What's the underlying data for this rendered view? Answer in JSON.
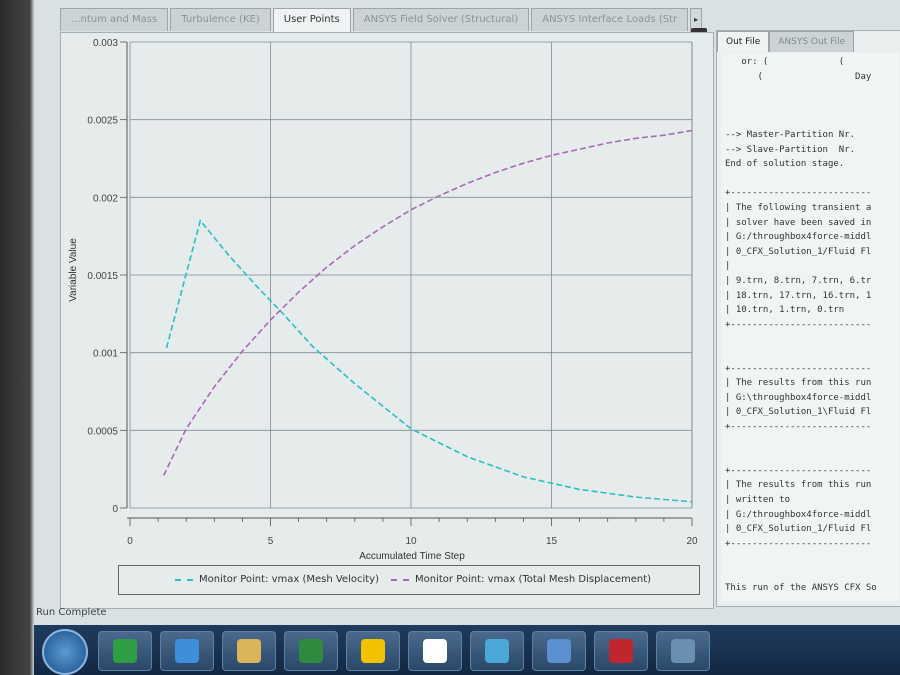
{
  "tabs": [
    "...ntum and Mass",
    "Turbulence (KE)",
    "User Points",
    "ANSYS Field Solver (Structural)",
    "ANSYS Interface Loads (Str"
  ],
  "active_tab": "User Points",
  "tab_scroll_glyph": "▸",
  "close_glyph": "✕",
  "chart_data": {
    "type": "line",
    "xlabel": "Accumulated Time Step",
    "ylabel": "Variable Value",
    "xlim": [
      0,
      20
    ],
    "ylim": [
      0,
      0.003
    ],
    "x_ticks": [
      "0",
      "5",
      "10",
      "15",
      "20"
    ],
    "y_ticks": [
      "0",
      "0.0005",
      "0.001",
      "0.0015",
      "0.002",
      "0.0025",
      "0.003"
    ],
    "grid": true,
    "legend_position": "bottom",
    "series": [
      {
        "name": "Monitor Point: vmax (Mesh Velocity)",
        "color": "#2bbfc4",
        "x": [
          1.3,
          2.5,
          3.5,
          4.5,
          5.5,
          6.5,
          8,
          10,
          12,
          14,
          16,
          18,
          20
        ],
        "y": [
          0.00103,
          0.00185,
          0.00163,
          0.00143,
          0.00124,
          0.00104,
          0.0008,
          0.00051,
          0.00033,
          0.0002,
          0.00012,
          7e-05,
          4e-05
        ]
      },
      {
        "name": "Monitor Point: vmax (Total Mesh Displacement)",
        "color": "#a968b8",
        "x": [
          1.2,
          2,
          3,
          4,
          5,
          6,
          7,
          8,
          9,
          10,
          11,
          12,
          13,
          14,
          15,
          16,
          17,
          18,
          19,
          20
        ],
        "y": [
          0.00021,
          0.00051,
          0.00078,
          0.00101,
          0.00121,
          0.00139,
          0.00155,
          0.00169,
          0.00181,
          0.00192,
          0.00201,
          0.00209,
          0.00216,
          0.00222,
          0.00227,
          0.00231,
          0.00235,
          0.00238,
          0.0024,
          0.00243
        ]
      }
    ]
  },
  "status": "Run Complete",
  "out_tabs": [
    "Out File",
    "ANSYS Out File"
  ],
  "out_lines": [
    "   or: (             (",
    "      (                 Day",
    "",
    "",
    "",
    "--> Master-Partition Nr.",
    "--> Slave-Partition  Nr.",
    "End of solution stage.",
    "",
    "+--------------------------",
    "| The following transient a",
    "| solver have been saved in",
    "| G:/throughbox4force-middl",
    "| 0_CFX_Solution_1/Fluid Fl",
    "|",
    "| 9.trn, 8.trn, 7.trn, 6.tr",
    "| 18.trn, 17.trn, 16.trn, 1",
    "| 10.trn, 1.trn, 0.trn",
    "+--------------------------",
    "",
    "",
    "+--------------------------",
    "| The results from this run",
    "| G:\\throughbox4force-middl",
    "| 0_CFX_Solution_1\\Fluid Fl",
    "+--------------------------",
    "",
    "",
    "+--------------------------",
    "| The results from this run",
    "| written to",
    "| G:/throughbox4force-middl",
    "| 0_CFX_Solution_1/Fluid Fl",
    "+--------------------------",
    "",
    "",
    "This run of the ANSYS CFX So"
  ],
  "taskbar": [
    {
      "name": "start-orb-icon"
    },
    {
      "name": "browser-icon",
      "color": "#2f9e44"
    },
    {
      "name": "internet-explorer-icon",
      "color": "#3c8fd8"
    },
    {
      "name": "file-explorer-icon",
      "color": "#d9b45a"
    },
    {
      "name": "excel-icon",
      "color": "#2e8b3e"
    },
    {
      "name": "ansys-workbench-icon",
      "color": "#f2c200"
    },
    {
      "name": "ansys-app-icon",
      "color": "#ffffff"
    },
    {
      "name": "network-app-icon",
      "color": "#4ca8d8"
    },
    {
      "name": "windows-app-icon",
      "color": "#5a8fd0"
    },
    {
      "name": "mcafee-icon",
      "color": "#c0262d"
    },
    {
      "name": "settings-app-icon",
      "color": "#6a8fb0"
    }
  ]
}
